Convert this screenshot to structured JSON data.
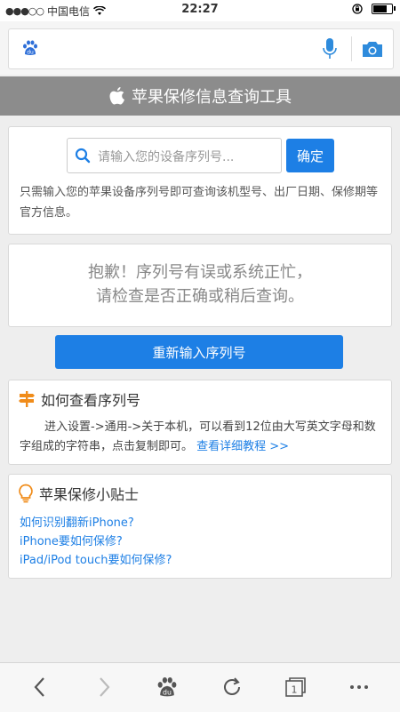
{
  "status": {
    "carrier": "中国电信",
    "time": "22:27",
    "battery_level": 0.85
  },
  "search": {
    "logo_icon": "baidu-paw-icon",
    "mic_icon": "microphone-icon",
    "camera_icon": "camera-icon"
  },
  "header": {
    "title": "苹果保修信息查询工具",
    "icon": "apple-logo-icon"
  },
  "query": {
    "placeholder": "请输入您的设备序列号...",
    "submit_label": "确定",
    "hint": "只需输入您的苹果设备序列号即可查询该机型号、出厂日期、保修期等官方信息。"
  },
  "error": {
    "line1": "抱歉！序列号有误或系统正忙，",
    "line2": "请检查是否正确或稍后查询。"
  },
  "retry_label": "重新输入序列号",
  "howto": {
    "title": "如何查看序列号",
    "text": "进入设置->通用->关于本机，可以看到12位由大写英文字母和数字组成的字符串，点击复制即可。",
    "link": "查看详细教程 >>"
  },
  "tips": {
    "title": "苹果保修小贴士",
    "links": [
      "如何识别翻新iPhone?",
      "iPhone要如何保修?",
      "iPad/iPod touch要如何保修?"
    ]
  },
  "toolbar": {
    "tab_count": "1"
  },
  "colors": {
    "accent": "#1d7fe5",
    "header_bg": "#8c8c8c",
    "icon_orange": "#f08c1a"
  }
}
